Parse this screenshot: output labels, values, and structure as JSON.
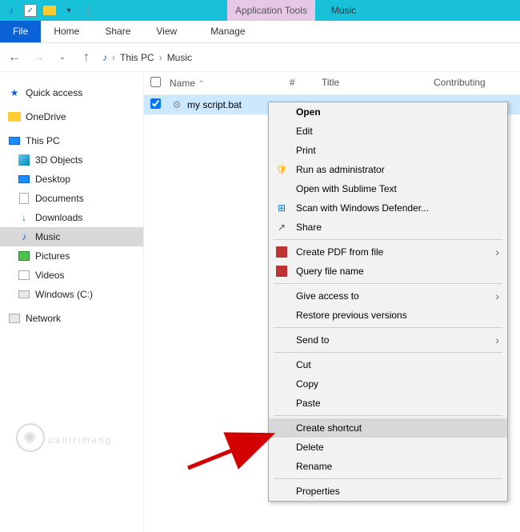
{
  "titlebar": {
    "contextual_label": "Application Tools",
    "window_title": "Music"
  },
  "ribbon": {
    "file": "File",
    "home": "Home",
    "share": "Share",
    "view": "View",
    "manage": "Manage"
  },
  "breadcrumbs": {
    "root": "This PC",
    "folder": "Music"
  },
  "sidebar": {
    "quick_access": "Quick access",
    "onedrive": "OneDrive",
    "this_pc": "This PC",
    "objects3d": "3D Objects",
    "desktop": "Desktop",
    "documents": "Documents",
    "downloads": "Downloads",
    "music": "Music",
    "pictures": "Pictures",
    "videos": "Videos",
    "windows_c": "Windows (C:)",
    "network": "Network"
  },
  "columns": {
    "name": "Name",
    "hash": "#",
    "title": "Title",
    "contributing": "Contributing"
  },
  "file": {
    "name": "my script.bat"
  },
  "ctx": {
    "open": "Open",
    "edit": "Edit",
    "print": "Print",
    "run_admin": "Run as administrator",
    "sublime": "Open with Sublime Text",
    "defender": "Scan with Windows Defender...",
    "share": "Share",
    "create_pdf": "Create PDF from file",
    "query": "Query file name",
    "give_access": "Give access to",
    "restore": "Restore previous versions",
    "send_to": "Send to",
    "cut": "Cut",
    "copy": "Copy",
    "paste": "Paste",
    "create_shortcut": "Create shortcut",
    "delete": "Delete",
    "rename": "Rename",
    "properties": "Properties"
  },
  "watermark": "uantrimang"
}
